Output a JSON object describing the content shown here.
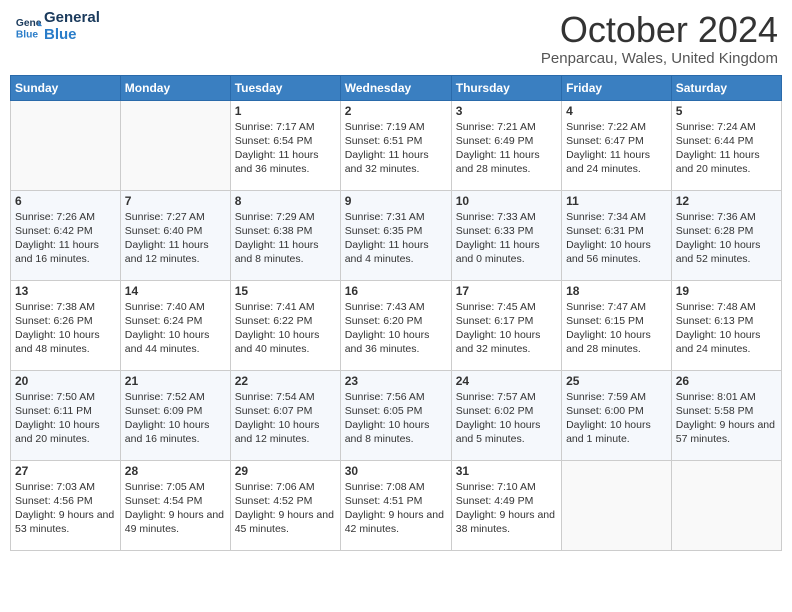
{
  "header": {
    "logo_line1": "General",
    "logo_line2": "Blue",
    "month": "October 2024",
    "location": "Penparcau, Wales, United Kingdom"
  },
  "days_of_week": [
    "Sunday",
    "Monday",
    "Tuesday",
    "Wednesday",
    "Thursday",
    "Friday",
    "Saturday"
  ],
  "weeks": [
    [
      {
        "day": "",
        "text": ""
      },
      {
        "day": "",
        "text": ""
      },
      {
        "day": "1",
        "text": "Sunrise: 7:17 AM\nSunset: 6:54 PM\nDaylight: 11 hours and 36 minutes."
      },
      {
        "day": "2",
        "text": "Sunrise: 7:19 AM\nSunset: 6:51 PM\nDaylight: 11 hours and 32 minutes."
      },
      {
        "day": "3",
        "text": "Sunrise: 7:21 AM\nSunset: 6:49 PM\nDaylight: 11 hours and 28 minutes."
      },
      {
        "day": "4",
        "text": "Sunrise: 7:22 AM\nSunset: 6:47 PM\nDaylight: 11 hours and 24 minutes."
      },
      {
        "day": "5",
        "text": "Sunrise: 7:24 AM\nSunset: 6:44 PM\nDaylight: 11 hours and 20 minutes."
      }
    ],
    [
      {
        "day": "6",
        "text": "Sunrise: 7:26 AM\nSunset: 6:42 PM\nDaylight: 11 hours and 16 minutes."
      },
      {
        "day": "7",
        "text": "Sunrise: 7:27 AM\nSunset: 6:40 PM\nDaylight: 11 hours and 12 minutes."
      },
      {
        "day": "8",
        "text": "Sunrise: 7:29 AM\nSunset: 6:38 PM\nDaylight: 11 hours and 8 minutes."
      },
      {
        "day": "9",
        "text": "Sunrise: 7:31 AM\nSunset: 6:35 PM\nDaylight: 11 hours and 4 minutes."
      },
      {
        "day": "10",
        "text": "Sunrise: 7:33 AM\nSunset: 6:33 PM\nDaylight: 11 hours and 0 minutes."
      },
      {
        "day": "11",
        "text": "Sunrise: 7:34 AM\nSunset: 6:31 PM\nDaylight: 10 hours and 56 minutes."
      },
      {
        "day": "12",
        "text": "Sunrise: 7:36 AM\nSunset: 6:28 PM\nDaylight: 10 hours and 52 minutes."
      }
    ],
    [
      {
        "day": "13",
        "text": "Sunrise: 7:38 AM\nSunset: 6:26 PM\nDaylight: 10 hours and 48 minutes."
      },
      {
        "day": "14",
        "text": "Sunrise: 7:40 AM\nSunset: 6:24 PM\nDaylight: 10 hours and 44 minutes."
      },
      {
        "day": "15",
        "text": "Sunrise: 7:41 AM\nSunset: 6:22 PM\nDaylight: 10 hours and 40 minutes."
      },
      {
        "day": "16",
        "text": "Sunrise: 7:43 AM\nSunset: 6:20 PM\nDaylight: 10 hours and 36 minutes."
      },
      {
        "day": "17",
        "text": "Sunrise: 7:45 AM\nSunset: 6:17 PM\nDaylight: 10 hours and 32 minutes."
      },
      {
        "day": "18",
        "text": "Sunrise: 7:47 AM\nSunset: 6:15 PM\nDaylight: 10 hours and 28 minutes."
      },
      {
        "day": "19",
        "text": "Sunrise: 7:48 AM\nSunset: 6:13 PM\nDaylight: 10 hours and 24 minutes."
      }
    ],
    [
      {
        "day": "20",
        "text": "Sunrise: 7:50 AM\nSunset: 6:11 PM\nDaylight: 10 hours and 20 minutes."
      },
      {
        "day": "21",
        "text": "Sunrise: 7:52 AM\nSunset: 6:09 PM\nDaylight: 10 hours and 16 minutes."
      },
      {
        "day": "22",
        "text": "Sunrise: 7:54 AM\nSunset: 6:07 PM\nDaylight: 10 hours and 12 minutes."
      },
      {
        "day": "23",
        "text": "Sunrise: 7:56 AM\nSunset: 6:05 PM\nDaylight: 10 hours and 8 minutes."
      },
      {
        "day": "24",
        "text": "Sunrise: 7:57 AM\nSunset: 6:02 PM\nDaylight: 10 hours and 5 minutes."
      },
      {
        "day": "25",
        "text": "Sunrise: 7:59 AM\nSunset: 6:00 PM\nDaylight: 10 hours and 1 minute."
      },
      {
        "day": "26",
        "text": "Sunrise: 8:01 AM\nSunset: 5:58 PM\nDaylight: 9 hours and 57 minutes."
      }
    ],
    [
      {
        "day": "27",
        "text": "Sunrise: 7:03 AM\nSunset: 4:56 PM\nDaylight: 9 hours and 53 minutes."
      },
      {
        "day": "28",
        "text": "Sunrise: 7:05 AM\nSunset: 4:54 PM\nDaylight: 9 hours and 49 minutes."
      },
      {
        "day": "29",
        "text": "Sunrise: 7:06 AM\nSunset: 4:52 PM\nDaylight: 9 hours and 45 minutes."
      },
      {
        "day": "30",
        "text": "Sunrise: 7:08 AM\nSunset: 4:51 PM\nDaylight: 9 hours and 42 minutes."
      },
      {
        "day": "31",
        "text": "Sunrise: 7:10 AM\nSunset: 4:49 PM\nDaylight: 9 hours and 38 minutes."
      },
      {
        "day": "",
        "text": ""
      },
      {
        "day": "",
        "text": ""
      }
    ]
  ]
}
